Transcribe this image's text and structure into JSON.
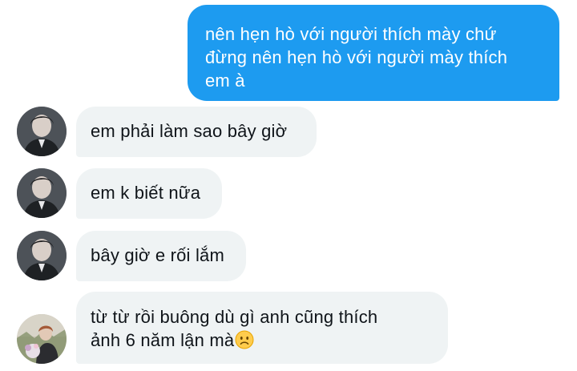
{
  "messages": {
    "outgoing": {
      "lines": [
        "nên hẹn hò với người thích mày chứ",
        "đừng nên hẹn hò với người mày thích",
        "em à"
      ],
      "color": "#1d9bf0"
    },
    "incoming": [
      {
        "text": "em phải làm sao bây giờ",
        "avatar_icon": "profile-photo-icon"
      },
      {
        "text": "em k biết nữa",
        "avatar_icon": "profile-photo-icon"
      },
      {
        "text": "bây giờ e rối lắm",
        "avatar_icon": "profile-photo-icon"
      },
      {
        "lines": [
          "từ từ rồi buông dù gì anh cũng thích",
          "ảnh 6 năm lận mà"
        ],
        "emoji": "slightly-frowning-face-icon",
        "avatar_icon": "profile-photo-icon"
      }
    ],
    "incoming_bubble_color": "#eff3f4"
  }
}
